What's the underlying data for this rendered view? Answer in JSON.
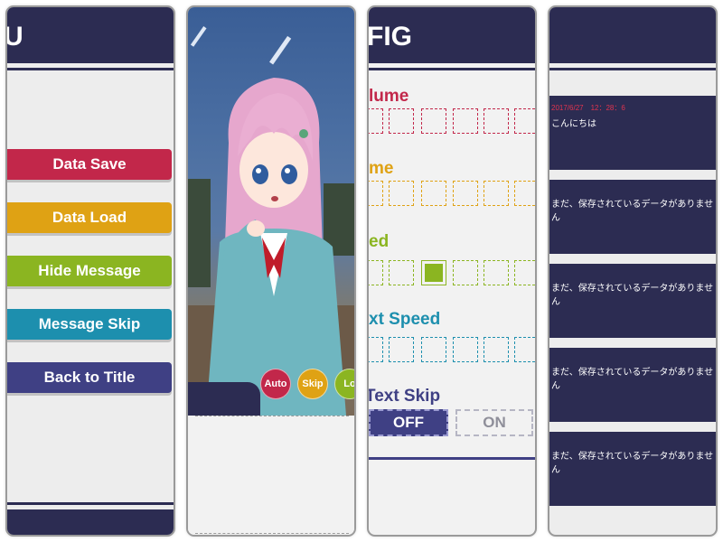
{
  "panels": {
    "menu": {
      "title": "U",
      "buttons": [
        {
          "label": "Data Save",
          "color": "#c2274a"
        },
        {
          "label": "Data Load",
          "color": "#dfa214"
        },
        {
          "label": "Hide Message",
          "color": "#8bb521"
        },
        {
          "label": "Message Skip",
          "color": "#1d8fae"
        },
        {
          "label": "Back to Title",
          "color": "#3f4084"
        }
      ]
    },
    "game": {
      "controls": [
        {
          "label": "Auto",
          "color": "#c2274a"
        },
        {
          "label": "Skip",
          "color": "#dfa214"
        },
        {
          "label": "Lo",
          "color": "#8bb521"
        }
      ]
    },
    "config": {
      "title": "FIG",
      "rows": [
        {
          "label": "lume",
          "color": "#c2274a",
          "filled": []
        },
        {
          "label": "me",
          "color": "#dfa214",
          "filled": []
        },
        {
          "label": "ed",
          "color": "#8bb521",
          "filled": [
            2
          ]
        },
        {
          "label": "xt Speed",
          "color": "#1d8fae",
          "filled": []
        },
        {
          "label": "Text Skip",
          "color": "#3f4084",
          "filled": []
        }
      ],
      "toggle_off": "OFF",
      "toggle_on": "ON"
    },
    "saves": {
      "slots": [
        {
          "date": "2017/6/27　12：28：6",
          "text": "こんにちは"
        },
        {
          "date": "",
          "text": "まだ、保存されているデータがありません"
        },
        {
          "date": "",
          "text": "まだ、保存されているデータがありません"
        },
        {
          "date": "",
          "text": "まだ、保存されているデータがありません"
        },
        {
          "date": "",
          "text": "まだ、保存されているデータがありません"
        }
      ]
    }
  }
}
